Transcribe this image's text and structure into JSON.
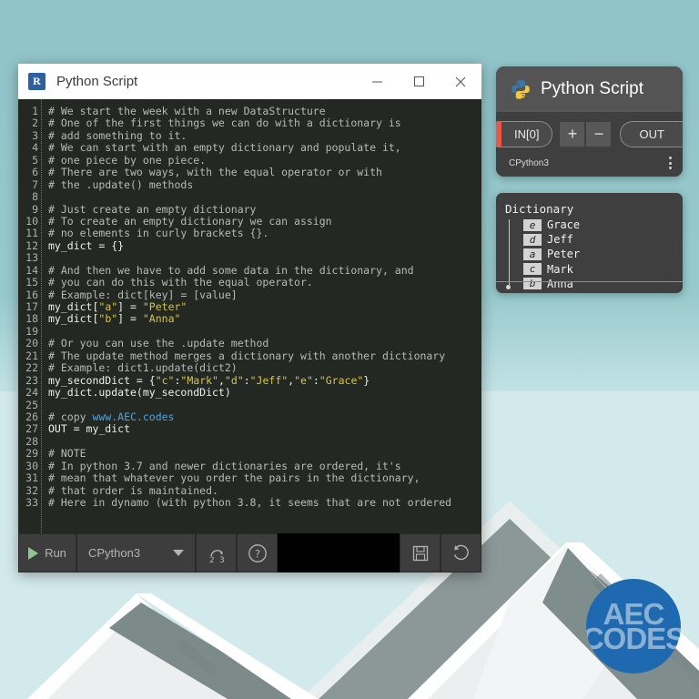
{
  "background": {
    "sky_color": "#9ec9cd",
    "roof_color": "#7d8a8a",
    "logo": {
      "line1": "AEC",
      "line2": "CODES",
      "color": "#1f69b0"
    }
  },
  "editor_window": {
    "icon": "revit-r-icon",
    "icon_letter": "R",
    "title": "Python Script",
    "controls": {
      "minimize": "minimize-icon",
      "maximize": "maximize-icon",
      "close": "close-icon"
    },
    "code_lines": [
      {
        "n": "1",
        "tokens": [
          {
            "t": "# We start the week with a new DataStructure",
            "c": "com"
          }
        ]
      },
      {
        "n": "2",
        "tokens": [
          {
            "t": "# One of the first things we can do with a dictionary is",
            "c": "com"
          }
        ]
      },
      {
        "n": "3",
        "tokens": [
          {
            "t": "# add something to it.",
            "c": "com"
          }
        ]
      },
      {
        "n": "4",
        "tokens": [
          {
            "t": "# We can start with an empty dictionary and populate it,",
            "c": "com"
          }
        ]
      },
      {
        "n": "5",
        "tokens": [
          {
            "t": "# one piece by one piece.",
            "c": "com"
          }
        ]
      },
      {
        "n": "6",
        "tokens": [
          {
            "t": "# There are two ways, with the equal operator or with",
            "c": "com"
          }
        ]
      },
      {
        "n": "7",
        "tokens": [
          {
            "t": "# the .update() methods",
            "c": "com"
          }
        ]
      },
      {
        "n": "8",
        "tokens": []
      },
      {
        "n": "9",
        "tokens": [
          {
            "t": "# Just create an empty dictionary",
            "c": "com"
          }
        ]
      },
      {
        "n": "10",
        "tokens": [
          {
            "t": "# To create an empty dictionary we can assign",
            "c": "com"
          }
        ]
      },
      {
        "n": "11",
        "tokens": [
          {
            "t": "# no elements in curly brackets {}.",
            "c": "com"
          }
        ]
      },
      {
        "n": "12",
        "tokens": [
          {
            "t": "my_dict = {}",
            "c": "txt"
          }
        ]
      },
      {
        "n": "13",
        "tokens": []
      },
      {
        "n": "14",
        "tokens": [
          {
            "t": "# And then we have to add some data in the dictionary, and",
            "c": "com"
          }
        ]
      },
      {
        "n": "15",
        "tokens": [
          {
            "t": "# you can do this with the equal operator.",
            "c": "com"
          }
        ]
      },
      {
        "n": "16",
        "tokens": [
          {
            "t": "# Example: dict[key] = [value]",
            "c": "com"
          }
        ]
      },
      {
        "n": "17",
        "tokens": [
          {
            "t": "my_dict[",
            "c": "txt"
          },
          {
            "t": "\"a\"",
            "c": "str"
          },
          {
            "t": "] = ",
            "c": "txt"
          },
          {
            "t": "\"Peter\"",
            "c": "str"
          }
        ]
      },
      {
        "n": "18",
        "tokens": [
          {
            "t": "my_dict[",
            "c": "txt"
          },
          {
            "t": "\"b\"",
            "c": "str"
          },
          {
            "t": "] = ",
            "c": "txt"
          },
          {
            "t": "\"Anna\"",
            "c": "str"
          }
        ]
      },
      {
        "n": "19",
        "tokens": []
      },
      {
        "n": "20",
        "tokens": [
          {
            "t": "# Or you can use the .update method",
            "c": "com"
          }
        ]
      },
      {
        "n": "21",
        "tokens": [
          {
            "t": "# The update method merges a dictionary with another dictionary",
            "c": "com"
          }
        ]
      },
      {
        "n": "22",
        "tokens": [
          {
            "t": "# Example: dict1.update(dict2)",
            "c": "com"
          }
        ]
      },
      {
        "n": "23",
        "tokens": [
          {
            "t": "my_secondDict = {",
            "c": "txt"
          },
          {
            "t": "\"c\"",
            "c": "str"
          },
          {
            "t": ":",
            "c": "txt"
          },
          {
            "t": "\"Mark\"",
            "c": "str"
          },
          {
            "t": ",",
            "c": "txt"
          },
          {
            "t": "\"d\"",
            "c": "str"
          },
          {
            "t": ":",
            "c": "txt"
          },
          {
            "t": "\"Jeff\"",
            "c": "str"
          },
          {
            "t": ",",
            "c": "txt"
          },
          {
            "t": "\"e\"",
            "c": "str"
          },
          {
            "t": ":",
            "c": "txt"
          },
          {
            "t": "\"Grace\"",
            "c": "str"
          },
          {
            "t": "}",
            "c": "txt"
          }
        ]
      },
      {
        "n": "24",
        "tokens": [
          {
            "t": "my_dict.update(my_secondDict)",
            "c": "txt"
          }
        ]
      },
      {
        "n": "25",
        "tokens": []
      },
      {
        "n": "26",
        "tokens": [
          {
            "t": "# copy ",
            "c": "com"
          },
          {
            "t": "www.AEC.codes",
            "c": "url"
          }
        ]
      },
      {
        "n": "27",
        "tokens": [
          {
            "t": "OUT = my_dict",
            "c": "txt"
          }
        ]
      },
      {
        "n": "28",
        "tokens": []
      },
      {
        "n": "29",
        "tokens": [
          {
            "t": "# NOTE",
            "c": "com"
          }
        ]
      },
      {
        "n": "30",
        "tokens": [
          {
            "t": "# In python 3.7 and newer dictionaries are ordered, it's",
            "c": "com"
          }
        ]
      },
      {
        "n": "31",
        "tokens": [
          {
            "t": "# mean that whatever you order the pairs in the dictionary,",
            "c": "com"
          }
        ]
      },
      {
        "n": "32",
        "tokens": [
          {
            "t": "# that order is maintained.",
            "c": "com"
          }
        ]
      },
      {
        "n": "33",
        "tokens": [
          {
            "t": "# Here in dynamo (with python 3.8, it seems that are not ordered",
            "c": "com"
          }
        ]
      }
    ],
    "toolbar": {
      "run_label": "Run",
      "run_icon": "play-icon",
      "engine_value": "CPython3",
      "engine_caret": "chevron-down-icon",
      "migrate_icon": "migrate-2-to-3-icon",
      "migrate_from": "2",
      "migrate_to": "3",
      "help_icon": "help-question-icon",
      "save_icon": "save-floppy-icon",
      "revert_icon": "revert-undo-icon"
    }
  },
  "dynamo_node": {
    "icon": "python-logo-icon",
    "title": "Python Script",
    "input_port": "IN[0]",
    "input_status_color": "#e8574a",
    "add_port_label": "+",
    "remove_port_label": "−",
    "output_port": "OUT",
    "engine_label": "CPython3",
    "menu_icon": "kebab-menu-icon"
  },
  "preview": {
    "title": "Dictionary",
    "rows": [
      {
        "key": "e",
        "value": "Grace"
      },
      {
        "key": "d",
        "value": "Jeff"
      },
      {
        "key": "a",
        "value": "Peter"
      },
      {
        "key": "c",
        "value": "Mark"
      },
      {
        "key": "b",
        "value": "Anna"
      }
    ]
  }
}
